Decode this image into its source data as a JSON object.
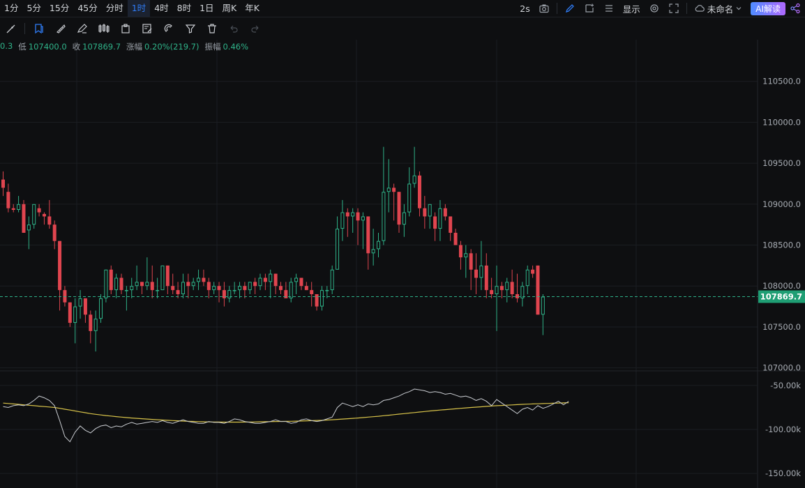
{
  "intervals": [
    {
      "label": "1分",
      "active": false
    },
    {
      "label": "5分",
      "active": false
    },
    {
      "label": "15分",
      "active": false
    },
    {
      "label": "45分",
      "active": false
    },
    {
      "label": "分时",
      "active": false
    },
    {
      "label": "1时",
      "active": true
    },
    {
      "label": "4时",
      "active": false
    },
    {
      "label": "8时",
      "active": false
    },
    {
      "label": "1日",
      "active": false
    },
    {
      "label": "周K",
      "active": false
    },
    {
      "label": "年K",
      "active": false
    }
  ],
  "toolbar_right": {
    "refresh": "2s",
    "display": "显示",
    "layout_name": "未命名",
    "ai_button": "AI解读"
  },
  "icons": [
    "camera-icon",
    "pen-icon",
    "add-window-icon",
    "list-icon",
    "gear-icon",
    "fullscreen-icon",
    "cloud-icon",
    "share-icon"
  ],
  "drawing_tools": [
    "brush-tool-icon",
    "bookmark-tool-icon",
    "ruler-icon",
    "pencil-icon",
    "candles-icon",
    "clipboard-icon",
    "note-edit-icon",
    "magnet-icon",
    "filter-icon",
    "trash-icon",
    "undo-icon",
    "redo-icon"
  ],
  "ohlc_info": {
    "high_tail": "0.3",
    "low_label": "低",
    "low": "107400.0",
    "close_label": "收",
    "close": "107869.7",
    "change_label": "涨幅",
    "change": "0.20%(219.7)",
    "amplitude_label": "振幅",
    "amplitude": "0.46%"
  },
  "colors": {
    "up": "#2fb389",
    "down": "#e0454f",
    "ma": "#d9c44a",
    "line": "#c9ccd1",
    "price_tag": "#1f9e74"
  },
  "chart_data": {
    "type": "candlestick",
    "price_axis": {
      "ticks": [
        107000.0,
        107500.0,
        108000.0,
        108500.0,
        109000.0,
        109500.0,
        110000.0,
        110500.0
      ],
      "ylim": [
        106980,
        111000
      ]
    },
    "current_price": 107869.7,
    "candles": [
      [
        109300,
        109400,
        109100,
        109200
      ],
      [
        109150,
        109250,
        108900,
        108950
      ],
      [
        108950,
        109000,
        108900,
        108930
      ],
      [
        108930,
        109100,
        108900,
        109000
      ],
      [
        109000,
        109050,
        108650,
        108650
      ],
      [
        108680,
        108850,
        108450,
        108750
      ],
      [
        108750,
        109000,
        108700,
        109000
      ],
      [
        108950,
        109000,
        108850,
        108900
      ],
      [
        108880,
        108900,
        108750,
        108850
      ],
      [
        108850,
        109050,
        108700,
        108750
      ],
      [
        108750,
        108800,
        108450,
        108550
      ],
      [
        108550,
        108550,
        107700,
        107950
      ],
      [
        107950,
        108000,
        107750,
        107800
      ],
      [
        107800,
        107800,
        107500,
        107550
      ],
      [
        107550,
        107850,
        107300,
        107750
      ],
      [
        107750,
        107950,
        107600,
        107850
      ],
      [
        107850,
        107850,
        107550,
        107650
      ],
      [
        107650,
        107700,
        107300,
        107450
      ],
      [
        107450,
        107700,
        107200,
        107600
      ],
      [
        107600,
        107900,
        107550,
        107850
      ],
      [
        107850,
        108200,
        107800,
        108200
      ],
      [
        108200,
        108250,
        107900,
        107950
      ],
      [
        107950,
        108150,
        107850,
        108100
      ],
      [
        108100,
        108150,
        107900,
        107950
      ],
      [
        107950,
        108000,
        107700,
        107950
      ],
      [
        107950,
        108100,
        107850,
        108000
      ],
      [
        108000,
        108250,
        107950,
        108050
      ],
      [
        108050,
        108050,
        107900,
        108000
      ],
      [
        108000,
        108350,
        107950,
        108050
      ],
      [
        108050,
        108250,
        107850,
        107950
      ],
      [
        107950,
        108100,
        107850,
        107950
      ],
      [
        107950,
        108200,
        107950,
        108250
      ],
      [
        108250,
        108250,
        107900,
        108000
      ],
      [
        108000,
        108150,
        107900,
        107950
      ],
      [
        107950,
        108050,
        107850,
        107900
      ],
      [
        107900,
        108150,
        107850,
        108050
      ],
      [
        108050,
        108150,
        107850,
        108000
      ],
      [
        108000,
        108100,
        107950,
        108050
      ],
      [
        108050,
        108200,
        107950,
        108100
      ],
      [
        108100,
        108200,
        108000,
        108050
      ],
      [
        108050,
        108100,
        107850,
        107950
      ],
      [
        107950,
        108050,
        107900,
        108000
      ],
      [
        108000,
        108050,
        107800,
        107950
      ],
      [
        107950,
        108050,
        107750,
        107850
      ],
      [
        107850,
        108000,
        107800,
        107950
      ],
      [
        107950,
        108050,
        107900,
        107950
      ],
      [
        107950,
        108050,
        107850,
        108000
      ],
      [
        108000,
        108050,
        107850,
        107950
      ],
      [
        107950,
        108050,
        107900,
        108050
      ],
      [
        108050,
        108100,
        107900,
        108000
      ],
      [
        108000,
        108150,
        107950,
        108100
      ],
      [
        108100,
        108150,
        107950,
        108050
      ],
      [
        108050,
        108200,
        107850,
        108150
      ],
      [
        108150,
        108150,
        107900,
        108000
      ],
      [
        108000,
        108050,
        107900,
        107950
      ],
      [
        107950,
        108050,
        107850,
        107850
      ],
      [
        107850,
        108100,
        107800,
        108050
      ],
      [
        108050,
        108150,
        107900,
        108100
      ],
      [
        108100,
        108100,
        107950,
        108000
      ],
      [
        108000,
        108050,
        107950,
        107950
      ],
      [
        107950,
        108050,
        107750,
        107900
      ],
      [
        107900,
        107900,
        107700,
        107750
      ],
      [
        107750,
        108000,
        107700,
        107950
      ],
      [
        107950,
        108000,
        107850,
        107950
      ],
      [
        107950,
        108250,
        107900,
        108200
      ],
      [
        108200,
        108850,
        108200,
        108700
      ],
      [
        108700,
        109050,
        108550,
        108900
      ],
      [
        108900,
        108950,
        108600,
        108850
      ],
      [
        108850,
        108950,
        108650,
        108900
      ],
      [
        108900,
        108950,
        108500,
        108800
      ],
      [
        108800,
        108900,
        108450,
        108850
      ],
      [
        108850,
        108850,
        108200,
        108400
      ],
      [
        108400,
        108700,
        108250,
        108450
      ],
      [
        108450,
        108650,
        108350,
        108550
      ],
      [
        108550,
        109700,
        108500,
        109150
      ],
      [
        109150,
        109550,
        108900,
        109200
      ],
      [
        109200,
        109250,
        108800,
        109150
      ],
      [
        109150,
        109150,
        108650,
        108750
      ],
      [
        108750,
        109000,
        108600,
        108900
      ],
      [
        108900,
        109450,
        108850,
        109250
      ],
      [
        109250,
        109700,
        109200,
        109350
      ],
      [
        109350,
        109400,
        108850,
        108950
      ],
      [
        108950,
        109100,
        108700,
        108850
      ],
      [
        108850,
        109000,
        108700,
        109000
      ],
      [
        108850,
        108900,
        108550,
        108700
      ],
      [
        108700,
        109050,
        108550,
        108950
      ],
      [
        108950,
        109000,
        108800,
        108850
      ],
      [
        108850,
        108850,
        108550,
        108650
      ],
      [
        108650,
        108700,
        108500,
        108500
      ],
      [
        108500,
        108550,
        108200,
        108350
      ],
      [
        108350,
        108500,
        108100,
        108400
      ],
      [
        108400,
        108450,
        107950,
        108200
      ],
      [
        108200,
        108400,
        107900,
        108100
      ],
      [
        108100,
        108550,
        107950,
        108250
      ],
      [
        108250,
        108400,
        107850,
        107950
      ],
      [
        107950,
        108100,
        107850,
        107900
      ],
      [
        107900,
        108250,
        107450,
        108000
      ],
      [
        108000,
        108050,
        107850,
        107950
      ],
      [
        107950,
        108100,
        107800,
        108050
      ],
      [
        108050,
        108200,
        107850,
        107900
      ],
      [
        107900,
        108150,
        107800,
        107850
      ],
      [
        107850,
        108050,
        107750,
        108000
      ],
      [
        108000,
        108250,
        107900,
        108200
      ],
      [
        108200,
        108250,
        108100,
        108150
      ],
      [
        108250,
        108250,
        107650,
        107650
      ],
      [
        107650,
        107900,
        107400,
        107870
      ]
    ],
    "indicator": {
      "ticks": [
        "-50.00k",
        "-100.00k",
        "-150.00k"
      ],
      "tick_values": [
        -50000,
        -100000,
        -150000
      ],
      "ylim": [
        -165000,
        -35000
      ],
      "line": [
        -74000,
        -75000,
        -73000,
        -72000,
        -73000,
        -71000,
        -67000,
        -62000,
        -64000,
        -67000,
        -73000,
        -90000,
        -108000,
        -114000,
        -103000,
        -96000,
        -101000,
        -104000,
        -99000,
        -96000,
        -95000,
        -98000,
        -96000,
        -97000,
        -94000,
        -92000,
        -94000,
        -93000,
        -92000,
        -91000,
        -92000,
        -90000,
        -92000,
        -93000,
        -91000,
        -89000,
        -91000,
        -92000,
        -93000,
        -93000,
        -91000,
        -92000,
        -92000,
        -93000,
        -91000,
        -88000,
        -89000,
        -91000,
        -92000,
        -93000,
        -93000,
        -92000,
        -91000,
        -89000,
        -91000,
        -91000,
        -93000,
        -92000,
        -89000,
        -88000,
        -90000,
        -91000,
        -90000,
        -88000,
        -86000,
        -75000,
        -70000,
        -72000,
        -74000,
        -72000,
        -74000,
        -71000,
        -72000,
        -71000,
        -67000,
        -66000,
        -64000,
        -62000,
        -59000,
        -57000,
        -54000,
        -55000,
        -56000,
        -58000,
        -57000,
        -58000,
        -60000,
        -59000,
        -61000,
        -63000,
        -62000,
        -64000,
        -67000,
        -65000,
        -68000,
        -73000,
        -66000,
        -70000,
        -74000,
        -78000,
        -82000,
        -77000,
        -75000,
        -78000,
        -73000,
        -76000,
        -74000,
        -71000,
        -68000,
        -72000,
        -68000
      ],
      "ma": [
        -70000,
        -70500,
        -71000,
        -71500,
        -72000,
        -72500,
        -73000,
        -73500,
        -74000,
        -74500,
        -75000,
        -76000,
        -77000,
        -78000,
        -79000,
        -80000,
        -81000,
        -82000,
        -82800,
        -83500,
        -84200,
        -84800,
        -85400,
        -86000,
        -86500,
        -87000,
        -87400,
        -87800,
        -88200,
        -88600,
        -89000,
        -89300,
        -89600,
        -89900,
        -90200,
        -90500,
        -90700,
        -90900,
        -91100,
        -91300,
        -91400,
        -91500,
        -91600,
        -91700,
        -91700,
        -91700,
        -91700,
        -91600,
        -91500,
        -91400,
        -91300,
        -91200,
        -91100,
        -91000,
        -90900,
        -90800,
        -90700,
        -90600,
        -90400,
        -90200,
        -90000,
        -89800,
        -89600,
        -89300,
        -89000,
        -88600,
        -88200,
        -87800,
        -87400,
        -87000,
        -86500,
        -86000,
        -85500,
        -85000,
        -84400,
        -83800,
        -83200,
        -82600,
        -82000,
        -81400,
        -80800,
        -80200,
        -79600,
        -79000,
        -78500,
        -78000,
        -77500,
        -77000,
        -76500,
        -76000,
        -75500,
        -75000,
        -74600,
        -74200,
        -73800,
        -73400,
        -73000,
        -72700,
        -72400,
        -72100,
        -71800,
        -71500,
        -71200,
        -71000,
        -70800,
        -70600,
        -70400,
        -70200,
        -70000,
        -69800,
        -69600
      ]
    }
  }
}
